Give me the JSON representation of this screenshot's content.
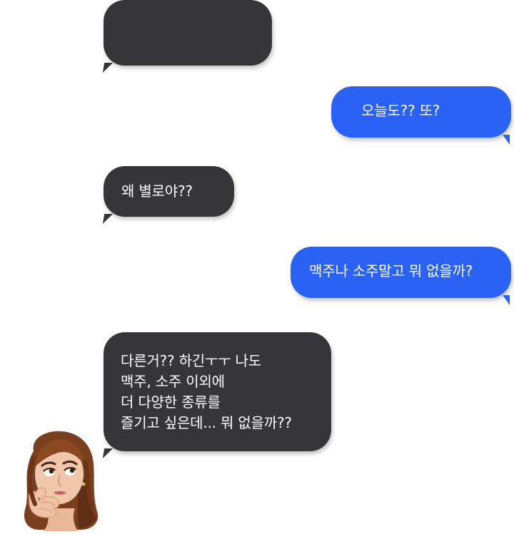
{
  "conversation": {
    "messages": [
      {
        "sender": "other",
        "text": ""
      },
      {
        "sender": "me",
        "text": "오늘도?? 또?"
      },
      {
        "sender": "other",
        "text": "왜 별로야??"
      },
      {
        "sender": "me",
        "text": "맥주나 소주말고 뭐 없을까?"
      },
      {
        "sender": "other",
        "text": "다른거?? 하긴ㅜㅜ 나도\n맥주, 소주 이외에\n더 다양한 종류를\n즐기고 싶은데... 뭐 없을까??"
      }
    ],
    "avatar_icon": "memoji-thinking-woman-icon"
  },
  "colors": {
    "incoming_bubble": "#363638",
    "outgoing_bubble": "#2b62f6",
    "text": "#ffffff"
  }
}
